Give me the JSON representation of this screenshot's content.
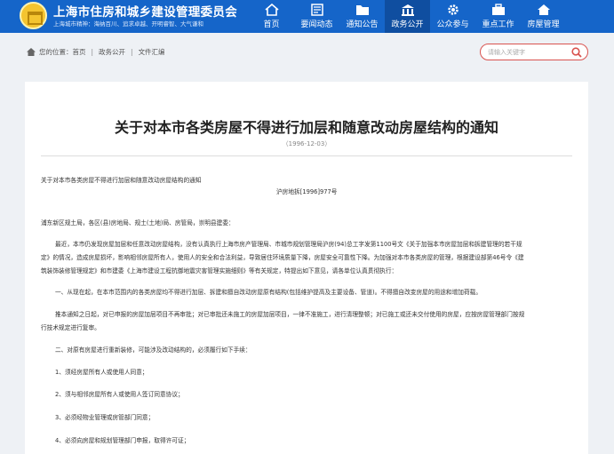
{
  "header": {
    "site_title": "上海市住房和城乡建设管理委员会",
    "slogan": "上海城市精神：海纳百川、追求卓越、开明睿智、大气谦和",
    "nav": [
      {
        "label": "首页",
        "icon": "home-icon"
      },
      {
        "label": "要闻动态",
        "icon": "newspaper-icon"
      },
      {
        "label": "通知公告",
        "icon": "folder-icon"
      },
      {
        "label": "政务公开",
        "icon": "building-icon"
      },
      {
        "label": "公众参与",
        "icon": "gear-icon"
      },
      {
        "label": "重点工作",
        "icon": "briefcase-icon"
      },
      {
        "label": "房屋管理",
        "icon": "house-icon"
      }
    ],
    "active_nav": "政务公开"
  },
  "breadcrumb": {
    "prefix": "您的位置：",
    "items": [
      "首页",
      "政务公开",
      "文件汇编"
    ],
    "separator": "|"
  },
  "search": {
    "placeholder": "请输入关键字"
  },
  "document": {
    "title": "关于对本市各类房屋不得进行加层和随意改动房屋结构的通知",
    "date": "（1996-12-03）",
    "heading": "关于对本市各类房屋不得进行加层和随意改动房屋结构的通知",
    "doc_number": "沪房地拆[1996]977号",
    "addressee": "浦东新区规土局，各区(县)房地局、规土(土地)局、房管局，崇明县建委：",
    "p1_l1": "最近，本市仍发现房屋加层和任意改动房屋结构，没有认真执行上海市房产管理局、市城市规划管理局沪房(94)总工字发第1100号文《关于加强本市房屋加层和拆建管理的若干规",
    "p1_l2": "定》的情况，造成房屋损坏，影响相邻房屋所有人，使用人的安全和合法利益，导致居住环境质量下降，房屋安全可靠性下降。为加强对本市各类房屋的管理，根据建设部第46号令《建",
    "p1_l3": "筑装饰装修管理规定》和市建委《上海市建设工程抗御地震灾害管理实施细则》等有关规定，特提出如下意见，请各单位认真贯彻执行：",
    "p2": "一、从现在起，在本市范围内的各类房屋均不得进行加层、拆建和擅自改动房屋原有结构(包括维护提高及主要设备、管道)。不得擅自改变房屋的用途和增加荷载。",
    "p3_l1": "推本通知之日起，对已申报的房屋加层项目不再审批；对已审批还未施工的房屋加层项目，一律不准施工，进行清理整顿；对已施工或还未交付使用的房屋，应按房屋管理部门按规",
    "p3_l2": "行技术规定进行复审。",
    "p4": "二、对原有房屋进行重新装修，可能涉及改动结构的，必须履行如下手续：",
    "i1": "1、须经房屋所有人或使用人同意；",
    "i2": "2、须与相邻房屋所有人或使用人签订同意协议；",
    "i3": "3、必须经物业管理或房管部门同意；",
    "i4": "4、必须向房屋和规划管理部门申报，取得许可证；"
  },
  "colors": {
    "header_blue": "#1565c9",
    "active_nav": "#0f4ea0",
    "search_border": "#d9534f",
    "background": "#eef1f5"
  }
}
